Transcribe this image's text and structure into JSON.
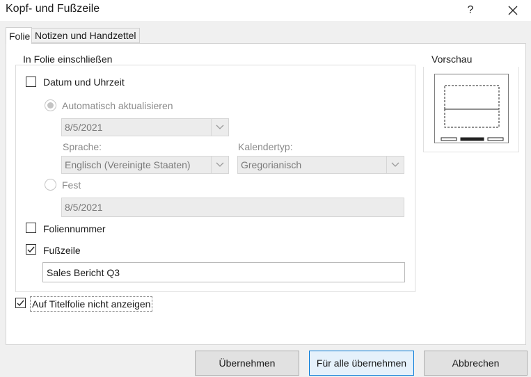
{
  "window": {
    "title": "Kopf- und Fußzeile",
    "help_label": "?",
    "close_label": "✕"
  },
  "tabs": [
    {
      "label": "Folie",
      "active": true
    },
    {
      "label": "Notizen und Handzettel",
      "active": false
    }
  ],
  "include_group": {
    "legend": "In Folie einschließen",
    "date_time": {
      "label": "Datum und Uhrzeit",
      "checked": false
    },
    "auto_update": {
      "label": "Automatisch aktualisieren",
      "selected": true,
      "enabled": false
    },
    "date_format": {
      "value": "8/5/2021"
    },
    "language": {
      "label": "Sprache:",
      "value": "Englisch (Vereinigte Staaten)"
    },
    "calendar": {
      "label": "Kalendertyp:",
      "value": "Gregorianisch"
    },
    "fixed": {
      "label": "Fest",
      "selected": false,
      "enabled": false
    },
    "fixed_value": "8/5/2021",
    "slide_number": {
      "label": "Foliennummer",
      "checked": false
    },
    "footer": {
      "label": "Fußzeile",
      "checked": true
    },
    "footer_text": "Sales Bericht Q3"
  },
  "dont_show_title": {
    "label": "Auf Titelfolie nicht anzeigen",
    "checked": true
  },
  "preview": {
    "legend": "Vorschau"
  },
  "buttons": {
    "apply": "Übernehmen",
    "apply_all": "Für alle übernehmen",
    "cancel": "Abbrechen"
  }
}
